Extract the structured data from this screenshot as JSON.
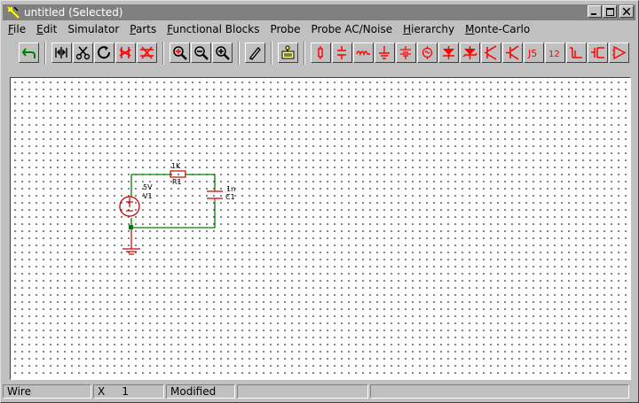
{
  "window": {
    "title": "untitled (Selected)"
  },
  "menu": [
    {
      "label": "File",
      "key": "F",
      "rest": "ile"
    },
    {
      "label": "Edit",
      "key": "E",
      "rest": "dit"
    },
    {
      "label": "Simulator",
      "key": "",
      "rest": "Simulator"
    },
    {
      "label": "Parts",
      "key": "P",
      "rest": "arts"
    },
    {
      "label": "Functional Blocks",
      "key": "F",
      "rest": "unctional Blocks"
    },
    {
      "label": "Probe",
      "key": "",
      "rest": "Probe"
    },
    {
      "label": "Probe AC/Noise",
      "key": "",
      "rest": "Probe AC/Noise"
    },
    {
      "label": "Hierarchy",
      "key": "H",
      "rest": "ierarchy"
    },
    {
      "label": "Monte-Carlo",
      "key": "M",
      "rest": "onte-Carlo"
    }
  ],
  "toolbar": {
    "groups": [
      [
        "undo-icon"
      ],
      [
        "mirror-icon",
        "cut-icon",
        "rotate-icon",
        "delete-component-icon",
        "delete-wire-icon"
      ],
      [
        "zoom-fit-icon",
        "zoom-out-icon",
        "zoom-in-icon"
      ],
      [
        "pencil-wire-icon"
      ],
      [
        "probe-icon"
      ],
      [
        "resistor-icon",
        "capacitor-icon",
        "inductor-icon",
        "ground-icon",
        "battery-icon",
        "ac-source-icon",
        "diode-icon",
        "zener-icon",
        "npn-transistor-icon",
        "pnp-transistor-icon",
        "current-source-icon",
        "voltage-source-icon",
        "nmos-icon",
        "pmos-icon",
        "opamp-icon"
      ]
    ]
  },
  "schematic": {
    "resistor_label": "1K",
    "resistor_name": "R1",
    "source_value": "5V",
    "source_name": "V1",
    "cap_value": "1n",
    "cap_name": "C1"
  },
  "status": {
    "mode": "Wire",
    "x_label": "X",
    "x_value": "1",
    "state": "Modified",
    "extra1": "",
    "extra2": ""
  },
  "colors": {
    "wire": "#008000",
    "part": "#cc0000",
    "accent": "#ff0000"
  }
}
